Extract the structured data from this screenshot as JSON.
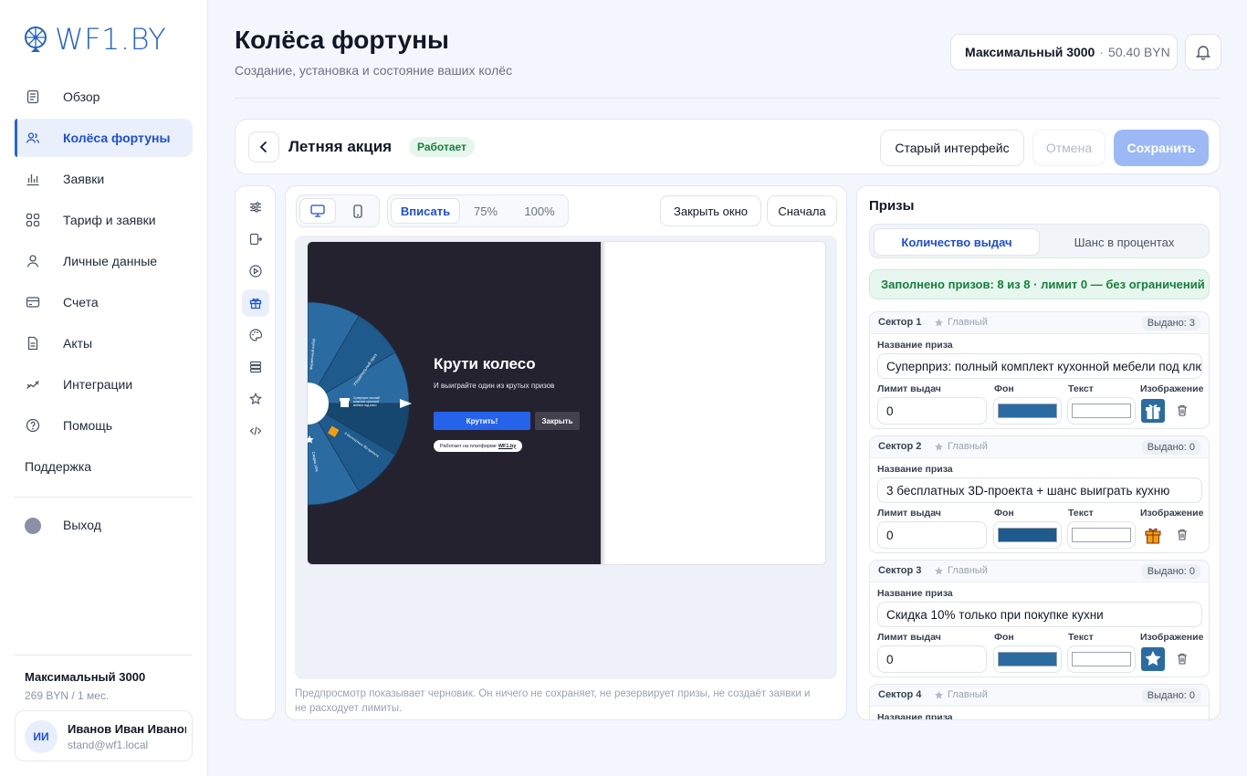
{
  "brand": {
    "name": "WF1.BY",
    "color": "#2563c9"
  },
  "sidebar": {
    "items": [
      {
        "label": "Обзор",
        "icon": "document-icon"
      },
      {
        "label": "Колёса фортуны",
        "icon": "users-icon",
        "active": true
      },
      {
        "label": "Заявки",
        "icon": "bar-chart-icon"
      },
      {
        "label": "Тариф и заявки",
        "icon": "grid-icon"
      },
      {
        "label": "Личные данные",
        "icon": "user-icon"
      },
      {
        "label": "Счета",
        "icon": "card-icon"
      },
      {
        "label": "Акты",
        "icon": "file-icon"
      },
      {
        "label": "Интеграции",
        "icon": "link-icon"
      },
      {
        "label": "Помощь",
        "icon": "help-icon"
      }
    ],
    "support": "Поддержка",
    "logout": "Выход",
    "plan": {
      "name": "Максимальный 3000",
      "price": "269 BYN / 1 мес."
    },
    "user": {
      "initials": "ИИ",
      "name": "Иванов Иван Иванович",
      "email": "stand@wf1.local"
    }
  },
  "header": {
    "title": "Колёса фортуны",
    "subtitle": "Создание, установка и состояние ваших колёс",
    "plan": "Максимальный 3000",
    "separator": "·",
    "balance": "50.40 BYN"
  },
  "wheel": {
    "name": "Летняя акция",
    "status": "Работает",
    "old_ui": "Старый интерфейс",
    "cancel": "Отмена",
    "save": "Сохранить"
  },
  "rail": {
    "icons": [
      "sliders-icon",
      "exit-icon",
      "play-icon",
      "gift-icon",
      "palette-icon",
      "layers-icon",
      "star-icon",
      "code-icon"
    ]
  },
  "preview": {
    "zoom": [
      {
        "label": "Вписать",
        "active": true
      },
      {
        "label": "75%"
      },
      {
        "label": "100%"
      }
    ],
    "close_window": "Закрыть окно",
    "restart": "Сначала",
    "widget": {
      "title": "Крути колесо",
      "subtitle": "И выиграйте один из крутых призов",
      "spin": "Крутить!",
      "close": "Закрыть",
      "badge_text": "Работает на платформе",
      "badge_link": "WF1.by",
      "bg": "#25222f",
      "sector_colors": [
        "#2a6ca2",
        "#1e5a8c",
        "#16476e"
      ]
    },
    "hint": "Предпросмотр показывает черновик. Он ничего не сохраняет, не резервирует призы, не создаёт заявки и не расходует лимиты."
  },
  "prizes": {
    "title": "Призы",
    "tabs": [
      {
        "label": "Количество выдач",
        "active": true
      },
      {
        "label": "Шанс в процентах"
      }
    ],
    "fill_info": "Заполнено призов: 8 из 8 · лимит 0 — без ограничений",
    "labels": {
      "prize_name": "Название приза",
      "limit": "Лимит выдач",
      "bg": "Фон",
      "text": "Текст",
      "image": "Изображение",
      "main": "Главный"
    },
    "sectors": [
      {
        "title": "Сектор 1",
        "issued": "Выдано: 3",
        "name": "Суперприз: полный комплект кухонной мебели под ключ",
        "limit": "0",
        "bg": "#2a6ca2",
        "text_color": "#ffffff",
        "image": "gift-icon"
      },
      {
        "title": "Сектор 2",
        "issued": "Выдано: 0",
        "name": "3 бесплатных 3D-проекта + шанс выиграть кухню",
        "limit": "0",
        "bg": "#1e5a8c",
        "text_color": "#ffffff",
        "image": "gift-orange-icon"
      },
      {
        "title": "Сектор 3",
        "issued": "Выдано: 0",
        "name": "Скидка 10% только при покупке кухни",
        "limit": "0",
        "bg": "#2a6ca2",
        "text_color": "#ffffff",
        "image": "star-icon"
      },
      {
        "title": "Сектор 4",
        "issued": "Выдано: 0",
        "name": "",
        "limit": "",
        "bg": "",
        "text_color": "",
        "image": ""
      }
    ]
  }
}
